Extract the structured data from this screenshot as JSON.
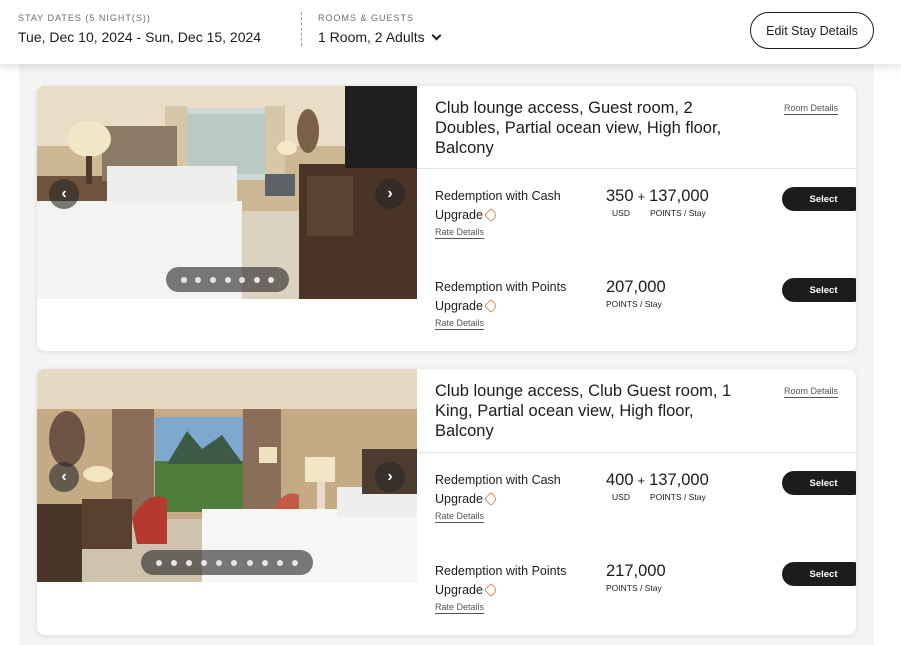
{
  "header": {
    "stay_dates_label": "STAY DATES (5 NIGHT(S))",
    "stay_dates_value": "Tue, Dec 10, 2024 - Sun, Dec 15, 2024",
    "rooms_label": "ROOMS & GUESTS",
    "rooms_value": "1 Room, 2 Adults",
    "edit_button": "Edit Stay Details"
  },
  "rooms": [
    {
      "title": "Club lounge access, Guest room, 2 Doubles, Partial ocean view, High floor, Balcony",
      "details_link": "Room Details",
      "carousel_dots": 7,
      "rates": [
        {
          "name_line1": "Redemption with Cash",
          "name_line2": "Upgrade",
          "link": "Rate Details",
          "cash": "350",
          "plus": "+",
          "points": "137,000",
          "cash_unit": "USD",
          "points_unit": "POINTS / Stay",
          "select": "Select"
        },
        {
          "name_line1": "Redemption with Points",
          "name_line2": "Upgrade",
          "link": "Rate Details",
          "points": "207,000",
          "points_unit": "POINTS / Stay",
          "select": "Select"
        }
      ]
    },
    {
      "title": "Club lounge access, Club Guest room, 1 King, Partial ocean view, High floor, Balcony",
      "details_link": "Room Details",
      "carousel_dots": 10,
      "rates": [
        {
          "name_line1": "Redemption with Cash",
          "name_line2": "Upgrade",
          "link": "Rate Details",
          "cash": "400",
          "plus": "+",
          "points": "137,000",
          "cash_unit": "USD",
          "points_unit": "POINTS / Stay",
          "select": "Select"
        },
        {
          "name_line1": "Redemption with Points",
          "name_line2": "Upgrade",
          "link": "Rate Details",
          "points": "217,000",
          "points_unit": "POINTS / Stay",
          "select": "Select"
        }
      ]
    }
  ],
  "icons": {
    "prev": "chevron-left-icon",
    "next": "chevron-right-icon",
    "dropdown": "chevron-down-icon",
    "upgrade": "tag-icon"
  },
  "colors": {
    "button_dark": "#1c1c1c",
    "tag_accent": "#e4885a",
    "page_background": "#f4f4f4"
  }
}
